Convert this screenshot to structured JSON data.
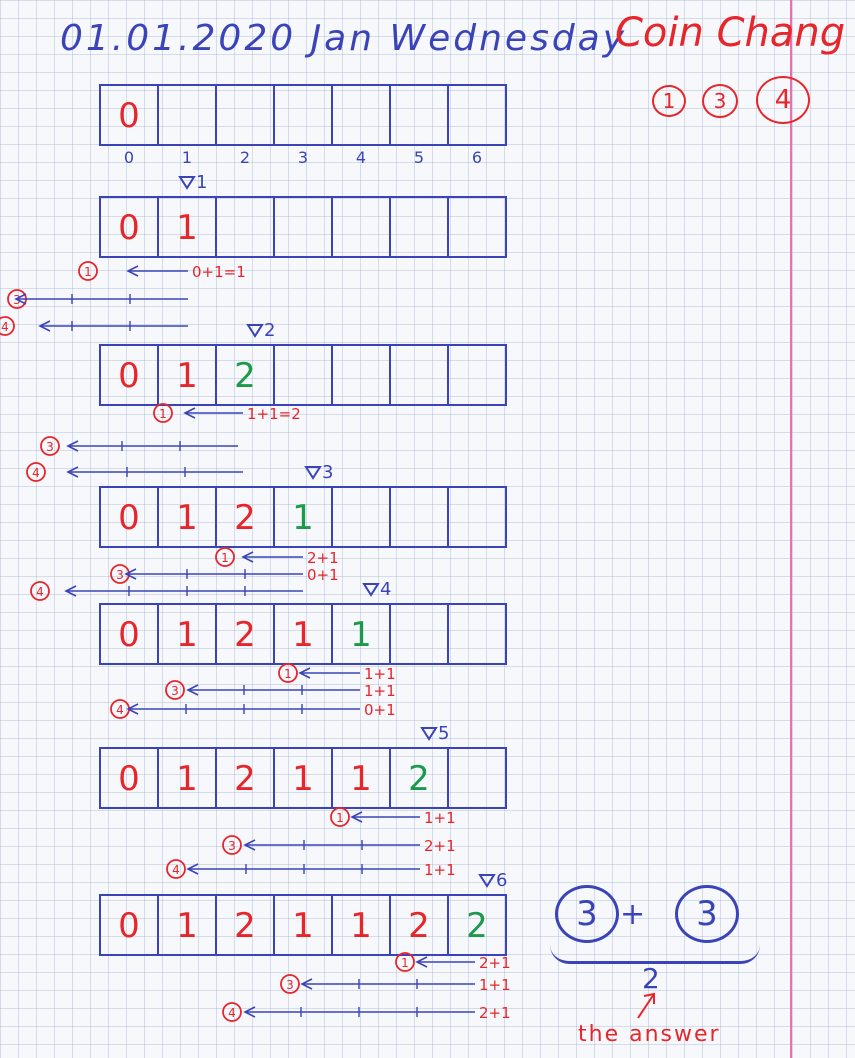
{
  "header": {
    "date_line": "01.01.2020 Jan Wednesday",
    "title": "Coin Chang"
  },
  "coins": [
    "1",
    "3",
    "4"
  ],
  "indices": [
    "0",
    "1",
    "2",
    "3",
    "4",
    "5",
    "6"
  ],
  "rows": [
    {
      "marker": "",
      "cells": [
        "0",
        "",
        "",
        "",
        "",
        "",
        ""
      ]
    },
    {
      "marker": "1",
      "cells": [
        "0",
        "1",
        "",
        "",
        "",
        "",
        ""
      ]
    },
    {
      "marker": "2",
      "cells": [
        "0",
        "1",
        "2",
        "",
        "",
        "",
        ""
      ]
    },
    {
      "marker": "3",
      "cells": [
        "0",
        "1",
        "2",
        "1",
        "",
        "",
        ""
      ]
    },
    {
      "marker": "4",
      "cells": [
        "0",
        "1",
        "2",
        "1",
        "1",
        "",
        ""
      ]
    },
    {
      "marker": "5",
      "cells": [
        "0",
        "1",
        "2",
        "1",
        "1",
        "2",
        ""
      ]
    },
    {
      "marker": "6",
      "cells": [
        "0",
        "1",
        "2",
        "1",
        "1",
        "2",
        "2"
      ]
    }
  ],
  "notes": [
    {
      "coin": "1",
      "text": "0+1=1"
    },
    {
      "coin": "3",
      "text": ""
    },
    {
      "coin": "4",
      "text": ""
    },
    {
      "coin": "1",
      "text": "1+1=2"
    },
    {
      "coin": "3",
      "text": ""
    },
    {
      "coin": "4",
      "text": ""
    },
    {
      "coin": "1",
      "text": "2+1"
    },
    {
      "coin": "3",
      "text": "0+1"
    },
    {
      "coin": "4",
      "text": ""
    },
    {
      "coin": "1",
      "text": "1+1"
    },
    {
      "coin": "3",
      "text": "1+1"
    },
    {
      "coin": "4",
      "text": "0+1"
    },
    {
      "coin": "1",
      "text": "1+1"
    },
    {
      "coin": "3",
      "text": "2+1"
    },
    {
      "coin": "4",
      "text": "1+1"
    },
    {
      "coin": "1",
      "text": "2+1"
    },
    {
      "coin": "3",
      "text": "1+1"
    },
    {
      "coin": "4",
      "text": "2+1"
    }
  ],
  "summary": {
    "left_coin": "3",
    "plus": "+",
    "right_coin": "3",
    "result": "2",
    "label": "the answer"
  },
  "colors": {
    "ink_blue": "#3a44b8",
    "ink_red": "#e6262b",
    "ink_green": "#1a9a4a",
    "margin": "#e76fb2"
  }
}
